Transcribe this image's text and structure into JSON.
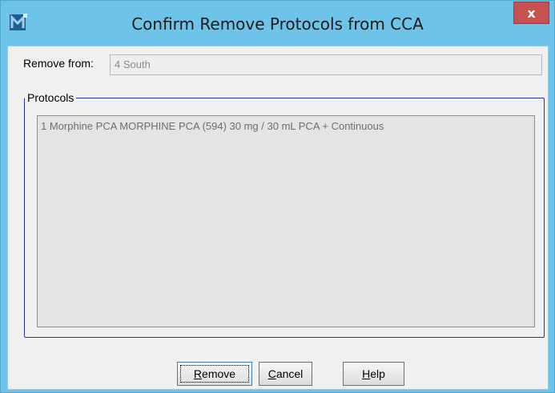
{
  "window": {
    "title": "Confirm Remove Protocols from CCA",
    "close_glyph": "x",
    "app_icon": "app-logo-icon"
  },
  "remove_from": {
    "label": "Remove from:",
    "value": "4 South"
  },
  "protocols": {
    "group_title": "Protocols",
    "items": [
      "1 Morphine PCA MORPHINE PCA (594) 30 mg / 30 mL PCA + Continuous"
    ]
  },
  "buttons": {
    "remove": {
      "accel": "R",
      "rest": "emove"
    },
    "cancel": {
      "accel": "C",
      "rest": "ancel"
    },
    "help": {
      "accel": "H",
      "rest": "elp"
    }
  },
  "colors": {
    "titlebar": "#6ec3e8",
    "close": "#c75050",
    "group_border": "#27349a"
  }
}
